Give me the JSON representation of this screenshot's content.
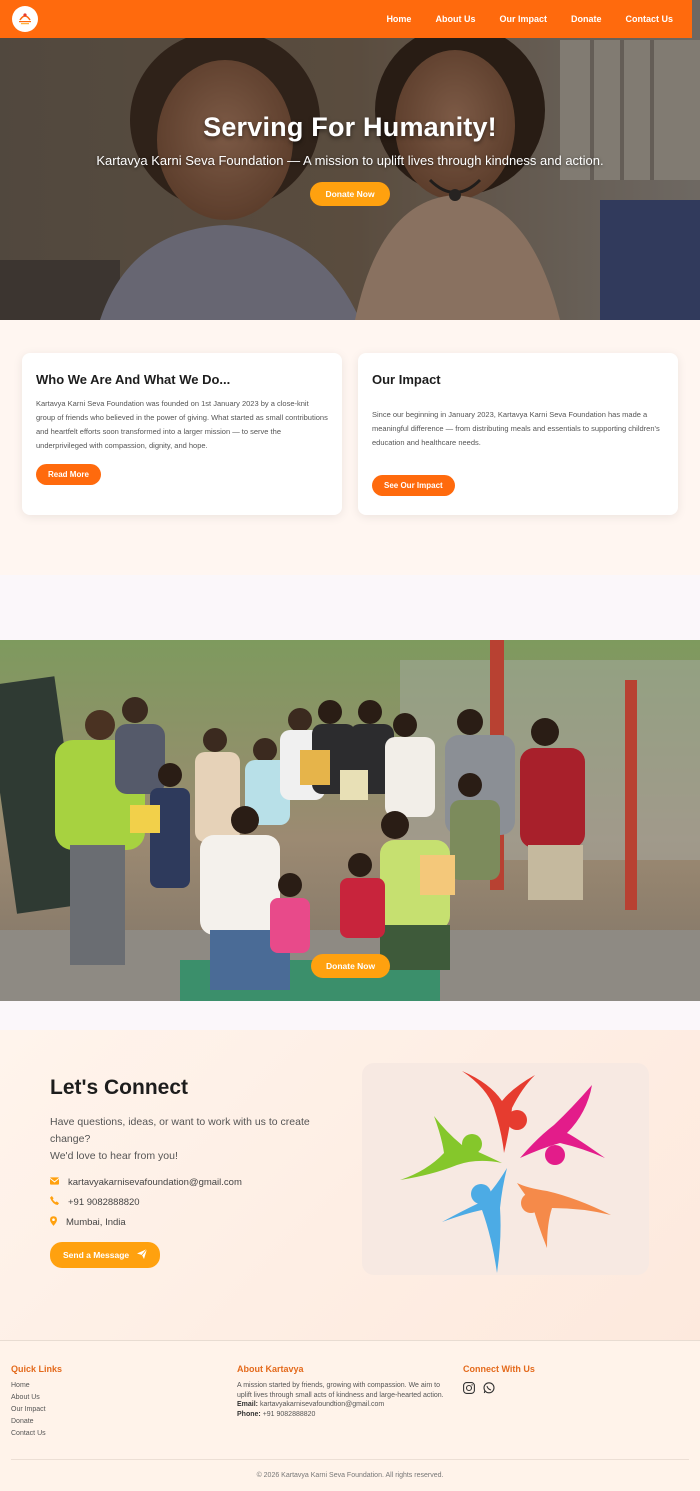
{
  "nav": {
    "links": [
      "Home",
      "About Us",
      "Our Impact",
      "Donate",
      "Contact Us"
    ],
    "brand_color": "#ff6a0d",
    "logo_icon": "organization-logo-icon"
  },
  "hero": {
    "title": "Serving For Humanity!",
    "subtitle": "Kartavya Karni Seva Foundation — A mission to uplift lives through kindness and action.",
    "button": "Donate Now"
  },
  "about": {
    "who": {
      "title": "Who We Are And What We Do...",
      "text": "Kartavya Karni Seva Foundation was founded on 1st January 2023 by a close-knit group of friends who believed in the power of giving. What started as small contributions and heartfelt efforts soon transformed into a larger mission — to serve the underprivileged with compassion, dignity, and hope.",
      "button": "Read More"
    },
    "impact": {
      "title": "Our Impact",
      "text": "Since our beginning in January 2023, Kartavya Karni Seva Foundation has made a meaningful difference — from distributing meals and essentials to supporting children's education and healthcare needs.",
      "button": "See Our Impact"
    }
  },
  "gallery": {
    "button": "Donate Now"
  },
  "connect": {
    "title": "Let's Connect",
    "desc_line1": "Have questions, ideas, or want to work with us to create change?",
    "desc_line2": "We'd love to hear from you!",
    "email": "kartavyakarnisevafoundation@gmail.com",
    "phone": "+91 9082888820",
    "location": "Mumbai, India",
    "button": "Send a Message",
    "accent": "#ffa10f"
  },
  "footer": {
    "quick_links_title": "Quick Links",
    "quick_links": [
      "Home",
      "About Us",
      "Our Impact",
      "Donate",
      "Contact Us"
    ],
    "about_title": "About Kartavya",
    "about_text": "A mission started by friends, growing with compassion. We aim to uplift lives through small acts of kindness and large-hearted action.",
    "email_label": "Email:",
    "email": "kartavyakarnisevafoundtion@gmail.com",
    "phone_label": "Phone:",
    "phone": "+91 9082888820",
    "connect_title": "Connect With Us",
    "social_icons": [
      "instagram-icon",
      "whatsapp-icon"
    ],
    "copyright": "© 2026 Kartavya Karni Seva Foundation. All rights reserved."
  }
}
